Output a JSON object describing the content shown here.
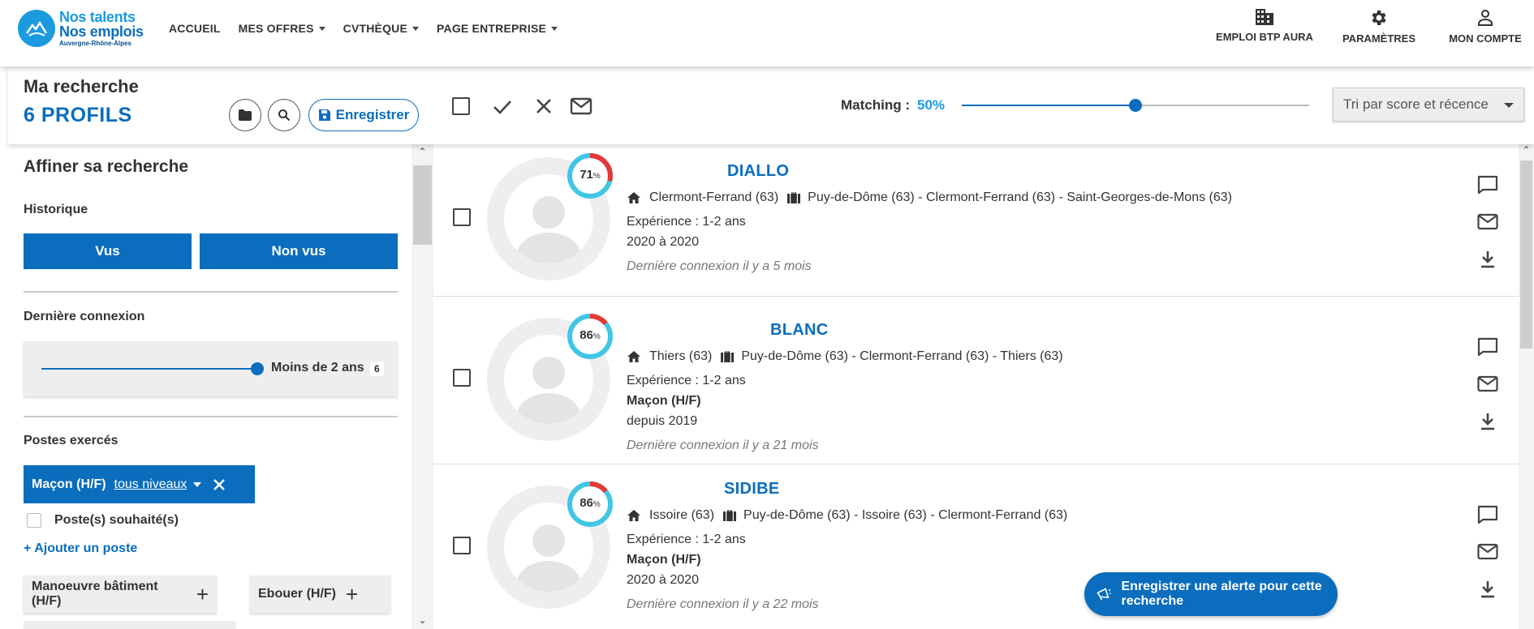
{
  "header": {
    "logo": {
      "line1": "Nos talents",
      "line2": "Nos emplois",
      "line3": "Auvergne-Rhône-Alpes"
    },
    "nav": [
      {
        "label": "ACCUEIL",
        "dropdown": false
      },
      {
        "label": "MES OFFRES",
        "dropdown": true
      },
      {
        "label": "CVTHÈQUE",
        "dropdown": true
      },
      {
        "label": "PAGE ENTREPRISE",
        "dropdown": true
      }
    ],
    "right": [
      {
        "label": "EMPLOI BTP AURA",
        "icon": "building-icon"
      },
      {
        "label": "PARAMÈTRES",
        "icon": "gear-icon"
      },
      {
        "label": "MON COMPTE",
        "icon": "user-icon"
      }
    ]
  },
  "search": {
    "title": "Ma recherche",
    "count_label": "6 PROFILS",
    "save_label": "Enregistrer",
    "matching_label": "Matching :",
    "matching_value": "50%",
    "matching_fraction": 0.5,
    "sort_label": "Tri par score et récence"
  },
  "filters": {
    "title": "Affiner sa recherche",
    "historique_label": "Historique",
    "tab_seen": "Vus",
    "tab_unseen": "Non vus",
    "last_conn_label": "Dernière connexion",
    "last_conn_value": "Moins de 2 ans",
    "last_conn_count": "6",
    "postes_label": "Postes exercés",
    "active_poste": "Maçon (H/F)",
    "active_level": "tous niveaux",
    "wished_label": "Poste(s) souhaité(s)",
    "add_label": "+ Ajouter un poste",
    "suggestions": [
      "Manoeuvre bâtiment (H/F)",
      "Ebouer (H/F)"
    ]
  },
  "candidates": [
    {
      "name": "DIALLO",
      "score": "71",
      "score_pct": 0.71,
      "home": "Clermont-Ferrand (63)",
      "zones": "Puy-de-Dôme (63) - Clermont-Ferrand (63) - Saint-Georges-de-Mons (63)",
      "experience": "Expérience : 1-2 ans",
      "job": "",
      "period": "2020 à 2020",
      "last_login": "Dernière connexion il y a 5 mois"
    },
    {
      "name": "BLANC",
      "score": "86",
      "score_pct": 0.86,
      "home": "Thiers (63)",
      "zones": "Puy-de-Dôme (63) - Clermont-Ferrand (63) - Thiers (63)",
      "experience": "Expérience : 1-2 ans",
      "job": "Maçon (H/F)",
      "period": "depuis 2019",
      "last_login": "Dernière connexion il y a 21 mois"
    },
    {
      "name": "SIDIBE",
      "score": "86",
      "score_pct": 0.86,
      "home": "Issoire (63)",
      "zones": "Puy-de-Dôme (63) - Issoire (63) - Clermont-Ferrand (63)",
      "experience": "Expérience : 1-2 ans",
      "job": "Maçon (H/F)",
      "period": "2020 à 2020",
      "last_login": "Dernière connexion il y a 22 mois"
    }
  ],
  "alert_button": "Enregistrer une alerte pour cette recherche",
  "colors": {
    "primary": "#0a6dbd",
    "accent": "#1b9ae0",
    "score_red": "#e53935",
    "score_cyan": "#3fc6e6"
  }
}
